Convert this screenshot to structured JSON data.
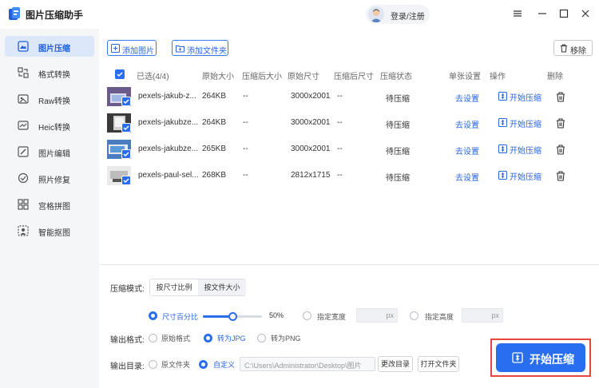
{
  "app": {
    "title": "图片压缩助手",
    "login": "登录/注册"
  },
  "sidebar": {
    "items": [
      {
        "label": "图片压缩",
        "icon": "image-compress-icon"
      },
      {
        "label": "格式转换",
        "icon": "format-convert-icon"
      },
      {
        "label": "Raw转换",
        "icon": "raw-convert-icon"
      },
      {
        "label": "Heic转换",
        "icon": "heic-convert-icon"
      },
      {
        "label": "图片编辑",
        "icon": "image-edit-icon"
      },
      {
        "label": "照片修复",
        "icon": "photo-repair-icon"
      },
      {
        "label": "宫格拼图",
        "icon": "grid-collage-icon"
      },
      {
        "label": "智能抠图",
        "icon": "smart-cutout-icon"
      }
    ],
    "active": "图片压缩"
  },
  "toolbar": {
    "add_image": "添加图片",
    "add_folder": "添加文件夹",
    "remove": "移除"
  },
  "table": {
    "headers": {
      "selected": "已选(4/4)",
      "orig_size": "原始大小",
      "comp_size": "压缩后大小",
      "orig_dim": "原始尺寸",
      "comp_dim": "压缩后尺寸",
      "status": "压缩状态",
      "single": "单张设置",
      "ops": "操作",
      "delete": "删除"
    },
    "rows": [
      {
        "name": "pexels-jakub-z...",
        "orig_size": "264KB",
        "comp_size": "--",
        "orig_dim": "3000x2001",
        "comp_dim": "--",
        "status": "待压缩",
        "setting": "去设置",
        "action": "开始压缩"
      },
      {
        "name": "pexels-jakubze...",
        "orig_size": "264KB",
        "comp_size": "--",
        "orig_dim": "3000x2001",
        "comp_dim": "--",
        "status": "待压缩",
        "setting": "去设置",
        "action": "开始压缩"
      },
      {
        "name": "pexels-jakubze...",
        "orig_size": "265KB",
        "comp_size": "--",
        "orig_dim": "3000x2001",
        "comp_dim": "--",
        "status": "待压缩",
        "setting": "去设置",
        "action": "开始压缩"
      },
      {
        "name": "pexels-paul-sel...",
        "orig_size": "268KB",
        "comp_size": "--",
        "orig_dim": "2812x1715",
        "comp_dim": "--",
        "status": "待压缩",
        "setting": "去设置",
        "action": "开始压缩"
      }
    ]
  },
  "settings": {
    "mode_label": "压缩模式:",
    "mode_options": [
      "按尺寸比例",
      "按文件大小"
    ],
    "mode_selected": "按尺寸比例",
    "size_percent_label": "尺寸百分比",
    "size_percent_value": "50%",
    "slider_value": 0.5,
    "width_label": "指定宽度",
    "height_label": "指定高度",
    "px_unit": "px",
    "format_label": "输出格式:",
    "format_options": [
      "原始格式",
      "转为JPG",
      "转为PNG"
    ],
    "format_selected": "转为JPG",
    "dir_label": "输出目录:",
    "dir_options": [
      "原文件夹",
      "自定义"
    ],
    "dir_selected": "自定义",
    "dir_path": "C:\\Users\\Administrator\\Desktop\\图片",
    "change_dir": "更改目录",
    "open_folder": "打开文件夹"
  },
  "start_button": "开始压缩",
  "colors": {
    "accent": "#2a6ef0",
    "highlight": "#e5473c",
    "sidebar_bg": "#f5f6f8",
    "active_bg": "#dde7fa"
  }
}
